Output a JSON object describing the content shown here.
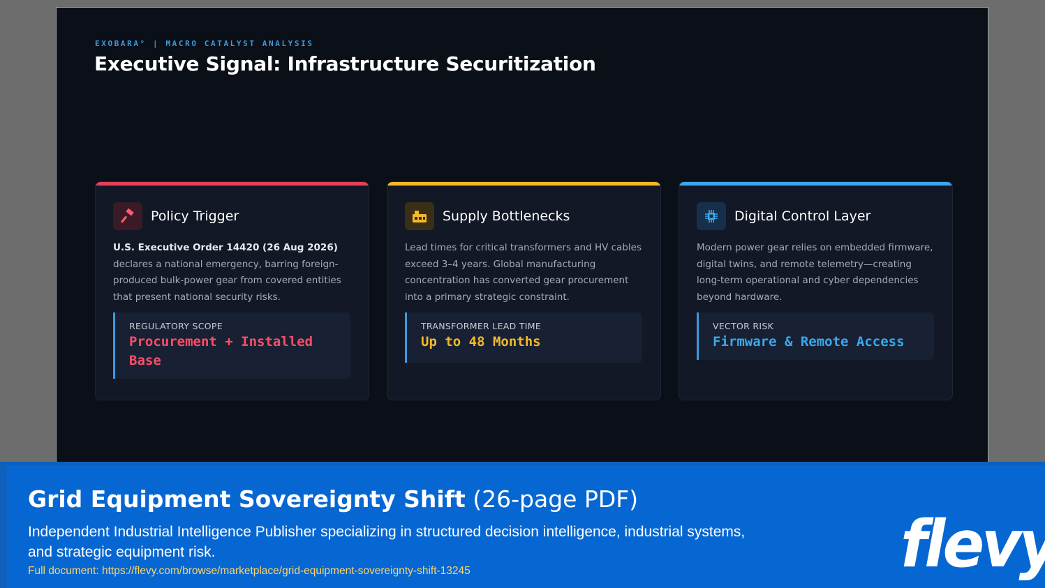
{
  "slide": {
    "kicker": "EXOBARA° | MACRO CATALYST ANALYSIS",
    "title": "Executive Signal: Infrastructure Securitization",
    "cards": [
      {
        "title": "Policy Trigger",
        "icon": "gavel-icon",
        "accent": "#e8405a",
        "body_bold": "U.S. Executive Order 14420 (26 Aug 2026)",
        "body_rest": " declares a national emergency, barring foreign-produced bulk-power gear from covered entities that present national security risks.",
        "callout_label": "REGULATORY SCOPE",
        "callout_value": "Procurement + Installed Base"
      },
      {
        "title": "Supply Bottlenecks",
        "icon": "factory-icon",
        "accent": "#f5b82a",
        "body_bold": "",
        "body_rest": "Lead times for critical transformers and HV cables exceed 3–4 years. Global manufacturing concentration has converted gear procurement into a primary strategic constraint.",
        "callout_label": "TRANSFORMER LEAD TIME",
        "callout_value": "Up to 48 Months"
      },
      {
        "title": "Digital Control Layer",
        "icon": "chip-icon",
        "accent": "#3aa8ee",
        "body_bold": "",
        "body_rest": "Modern power gear relies on embedded firmware, digital twins, and remote telemetry—creating long-term operational and cyber dependencies beyond hardware.",
        "callout_label": "VECTOR RISK",
        "callout_value": "Firmware & Remote Access"
      }
    ]
  },
  "footer": {
    "title_bold": "Grid Equipment Sovereignty Shift",
    "title_rest": " (26-page PDF)",
    "description": "Independent Industrial Intelligence Publisher specializing in structured decision intelligence, industrial systems, and strategic equipment risk.",
    "link": "Full document: https://flevy.com/browse/marketplace/grid-equipment-sovereignty-shift-13245",
    "logo": "flevy"
  }
}
